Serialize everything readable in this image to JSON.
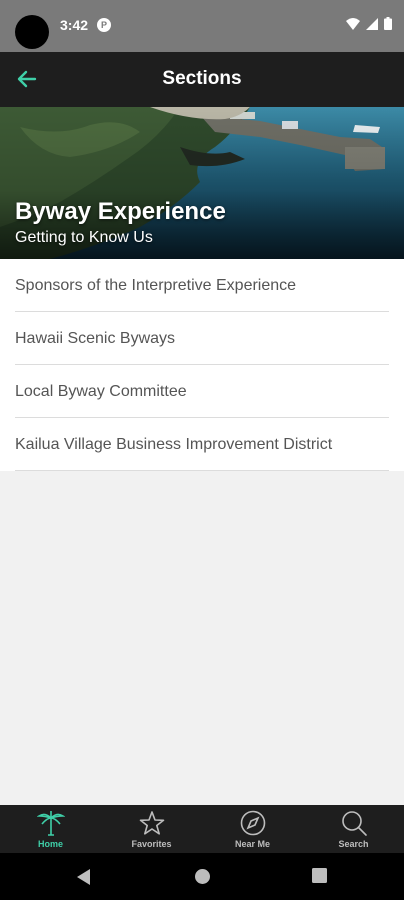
{
  "status": {
    "time": "3:42",
    "app_badge": "P"
  },
  "app_bar": {
    "title": "Sections",
    "accent": "#3fcfa8"
  },
  "hero": {
    "title": "Byway Experience",
    "subtitle": "Getting to Know Us"
  },
  "sections": [
    {
      "label": "Sponsors of the Interpretive Experience"
    },
    {
      "label": "Hawaii Scenic Byways"
    },
    {
      "label": "Local Byway Committee"
    },
    {
      "label": "Kailua Village Business Improvement District"
    }
  ],
  "bottom_nav": [
    {
      "label": "Home",
      "icon": "palm-tree-icon",
      "active": true
    },
    {
      "label": "Favorites",
      "icon": "star-icon",
      "active": false
    },
    {
      "label": "Near Me",
      "icon": "compass-icon",
      "active": false
    },
    {
      "label": "Search",
      "icon": "search-icon",
      "active": false
    }
  ]
}
